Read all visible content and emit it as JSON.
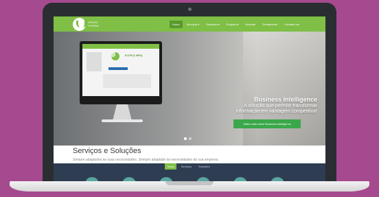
{
  "nav": {
    "logo_text": "GRUPO VITORIA",
    "items": [
      {
        "label": "Home",
        "active": true
      },
      {
        "label": "Serviços ▾",
        "active": false
      },
      {
        "label": "Soluções ▾",
        "active": false
      },
      {
        "label": "Projetos ▾",
        "active": false
      },
      {
        "label": "Notícias",
        "active": false
      },
      {
        "label": "Treinamento",
        "active": false
      },
      {
        "label": "Contate-nos",
        "active": false
      }
    ]
  },
  "hero": {
    "title": "Business Intelligence",
    "subtitle_line1": "A solução que permite transformar",
    "subtitle_line2": "informação em vantagem competitiva!",
    "cta": "Saiba mais sobre Business Intelligence",
    "monitor_percent": "5.175 (1.48%)"
  },
  "section": {
    "title": "Serviços e Soluções",
    "subtitle": "Sempre adaptados às suas necessidades. Sempre adaptado às necessidades da sua empresa."
  },
  "tabs": [
    {
      "label": "Todas",
      "active": true
    },
    {
      "label": "Serviços",
      "active": false
    },
    {
      "label": "Soluções",
      "active": false
    }
  ],
  "colors": {
    "background": "#a64a8f",
    "brand_green": "#7fbf45",
    "cta_green": "#3aa84a",
    "dark_section": "#2f3d52"
  }
}
